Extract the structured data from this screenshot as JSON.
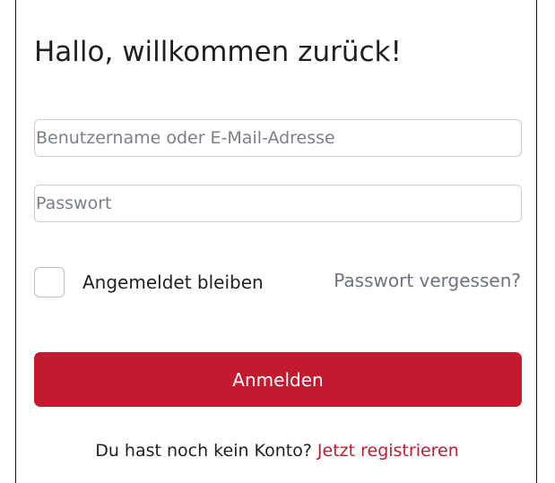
{
  "login": {
    "title": "Hallo, willkommen zurück!",
    "username_placeholder": "Benutzername oder E-Mail-Adresse",
    "username_value": "",
    "password_placeholder": "Passwort",
    "password_value": "",
    "remember_label": "Angemeldet bleiben",
    "remember_checked": false,
    "forgot_label": "Passwort vergessen?",
    "submit_label": "Anmelden",
    "register_prompt": "Du hast noch kein Konto?",
    "register_link": "Jetzt registrieren"
  },
  "colors": {
    "accent": "#c41a2f",
    "muted_text": "#6e7380",
    "field_border": "#c9cdd3"
  }
}
